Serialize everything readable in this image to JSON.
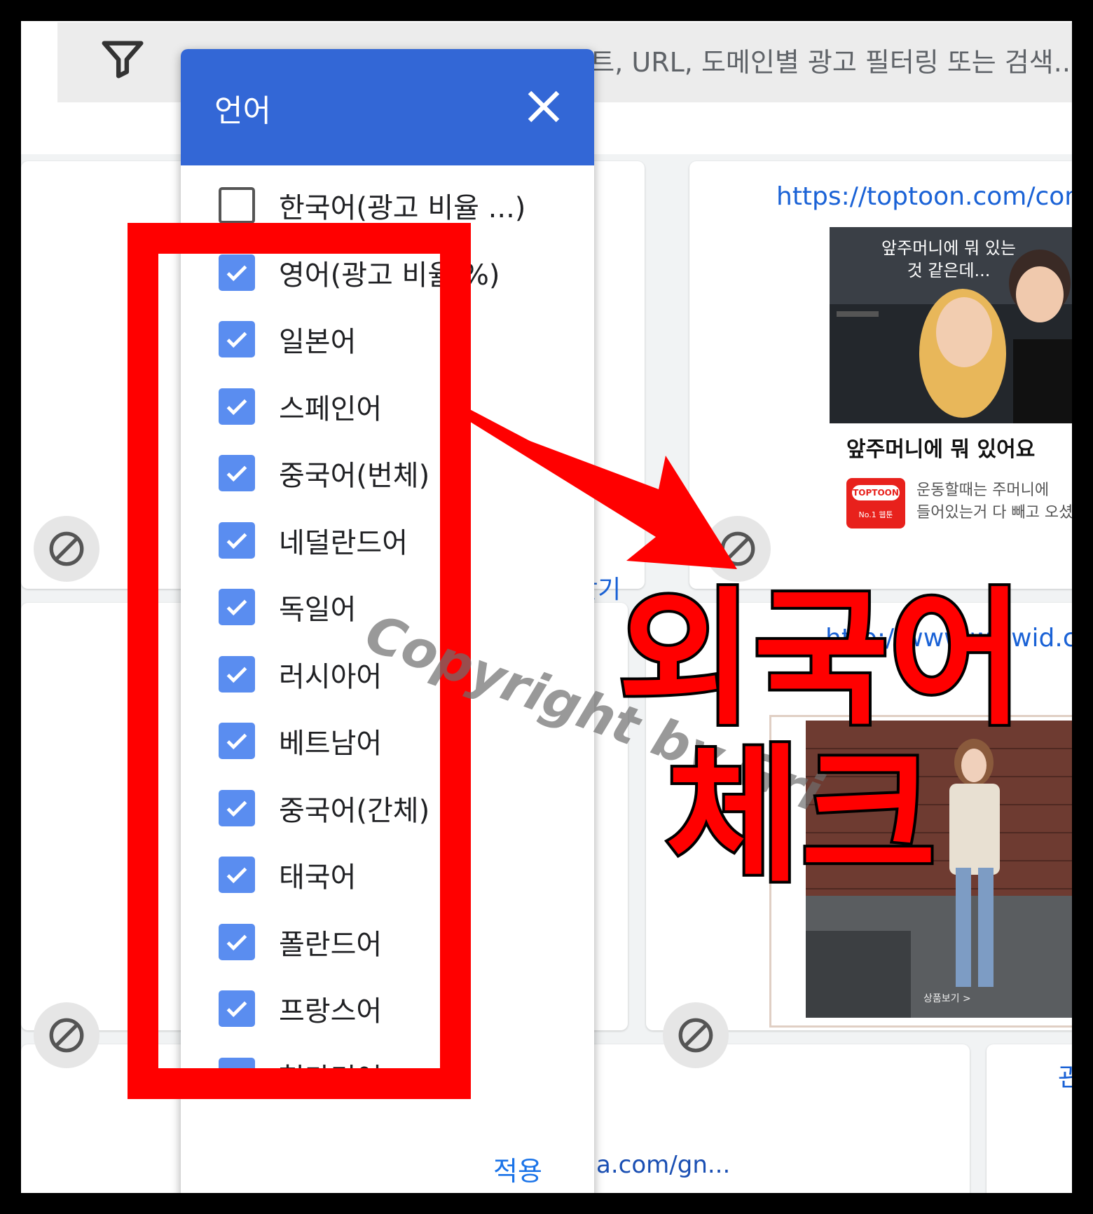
{
  "search": {
    "placeholder": "트, URL, 도메인별 광고 필터링 또는 검색..."
  },
  "language_dialog": {
    "title": "언어",
    "items": [
      {
        "label": "한국어(광고 비율 ...)",
        "checked": false
      },
      {
        "label": "영어(광고 비율 %)",
        "checked": true
      },
      {
        "label": "일본어",
        "checked": true
      },
      {
        "label": "스페인어",
        "checked": true
      },
      {
        "label": "중국어(번체)",
        "checked": true
      },
      {
        "label": "네덜란드어",
        "checked": true
      },
      {
        "label": "독일어",
        "checked": true
      },
      {
        "label": "러시아어",
        "checked": true
      },
      {
        "label": "베트남어",
        "checked": true
      },
      {
        "label": "중국어(간체)",
        "checked": true
      },
      {
        "label": "태국어",
        "checked": true
      },
      {
        "label": "폴란드어",
        "checked": true
      },
      {
        "label": "프랑스어",
        "checked": true
      },
      {
        "label": "헝가리어",
        "checked": true
      }
    ],
    "apply_label": "적용"
  },
  "cards": {
    "find_link_1": "찾기",
    "find_link_2": "기",
    "ad1": {
      "url": "https://toptoon.com/comic",
      "image_caption": "앞주머니에 뭐 있는 것 같은데...",
      "title": "앞주머니에 뭐 있어요",
      "logo_text": "TOPTOON",
      "logo_sub": "No.1 웹툰",
      "desc_line1": "운동할때는 주머니에",
      "desc_line2": "들어있는거 다 빼고 오셨어"
    },
    "ad2": {
      "url": "http://www.wizwid.com",
      "image_caption": "상품보기 >"
    },
    "right_edge_text": "관",
    "bottom_url": "dia.com/gn..."
  },
  "annotation": {
    "watermark": "Copyright by Gri",
    "line1": "외국어",
    "line2": "체크",
    "colors": {
      "highlight": "#ff0000",
      "checkbox": "#5a8df0",
      "header": "#3367d6",
      "link": "#1a62d6"
    }
  }
}
